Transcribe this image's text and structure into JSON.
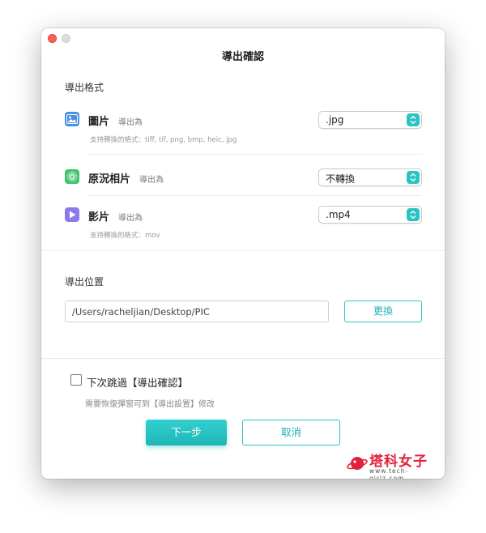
{
  "dialog": {
    "title": "導出確認",
    "format_section": "導出格式",
    "rows": [
      {
        "name": "圖片",
        "sub": "導出為",
        "selected": ".jpg",
        "hint": "支持轉換的格式：tiff, tif, png, bmp, heic, jpg",
        "icon": "image-icon"
      },
      {
        "name": "原況相片",
        "sub": "導出為",
        "selected": "不轉換",
        "icon": "live-photo-icon"
      },
      {
        "name": "影片",
        "sub": "導出為",
        "selected": ".mp4",
        "hint": "支持轉換的格式：mov",
        "icon": "video-play-icon"
      }
    ],
    "location_section": "導出位置",
    "path": "/Users/racheljian/Desktop/PIC",
    "change_label": "更換",
    "skip_label": "下次跳過【導出確認】",
    "note": "需要恢復彈窗可到【導出設置】修改",
    "next_label": "下一步",
    "cancel_label": "取消"
  },
  "watermark": {
    "text": "塔科女子",
    "url": "www.tech-girlz.com"
  },
  "colors": {
    "accent": "#2cc3c3",
    "close": "#fc5f57",
    "logo": "#e0213a"
  }
}
